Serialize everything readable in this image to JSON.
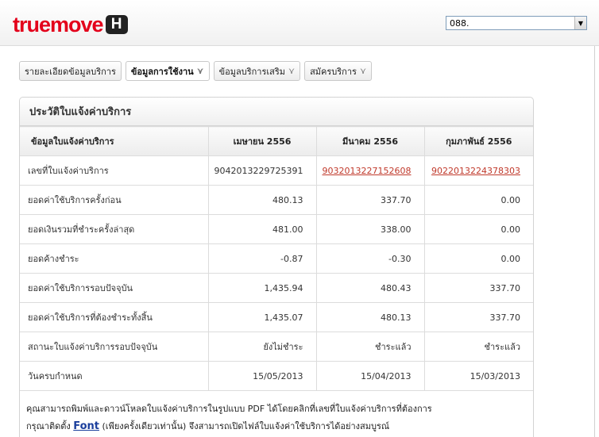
{
  "header": {
    "logo": {
      "part1": "true",
      "part2": "move",
      "badge": "H"
    },
    "number_select": {
      "value": "088."
    }
  },
  "tabs": [
    {
      "label": "รายละเอียดข้อมูลบริการ",
      "has_chevron": false,
      "active": false
    },
    {
      "label": "ข้อมูลการใช้งาน",
      "has_chevron": true,
      "active": true
    },
    {
      "label": "ข้อมูลบริการเสริม",
      "has_chevron": true,
      "active": false
    },
    {
      "label": "สมัครบริการ",
      "has_chevron": true,
      "active": false
    }
  ],
  "chevron_glyph": "⋎",
  "panel": {
    "title": "ประวัติใบแจ้งค่าบริการ",
    "table": {
      "headers": [
        "ข้อมูลใบแจ้งค่าบริการ",
        "เมษายน 2556",
        "มีนาคม 2556",
        "กุมภาพันธ์ 2556"
      ],
      "rows": [
        {
          "label": "เลขที่ใบแจ้งค่าบริการ",
          "cells": [
            "9042013229725391",
            "9032013227152608",
            "9022013224378303"
          ],
          "links": [
            false,
            true,
            true
          ]
        },
        {
          "label": "ยอดค่าใช้บริการครั้งก่อน",
          "cells": [
            "480.13",
            "337.70",
            "0.00"
          ]
        },
        {
          "label": "ยอดเงินรวมที่ชำระครั้งล่าสุด",
          "cells": [
            "481.00",
            "338.00",
            "0.00"
          ]
        },
        {
          "label": "ยอดค้างชำระ",
          "cells": [
            "-0.87",
            "-0.30",
            "0.00"
          ]
        },
        {
          "label": "ยอดค่าใช้บริการรอบปัจจุบัน",
          "cells": [
            "1,435.94",
            "480.43",
            "337.70"
          ]
        },
        {
          "label": "ยอดค่าใช้บริการที่ต้องชำระทั้งสิ้น",
          "cells": [
            "1,435.07",
            "480.13",
            "337.70"
          ]
        },
        {
          "label": "สถานะใบแจ้งค่าบริการรอบปัจจุบัน",
          "cells": [
            "ยังไม่ชำระ",
            "ชำระแล้ว",
            "ชำระแล้ว"
          ]
        },
        {
          "label": "วันครบกำหนด",
          "cells": [
            "15/05/2013",
            "15/04/2013",
            "15/03/2013"
          ]
        }
      ]
    },
    "footnote": {
      "line1": "คุณสามารถพิมพ์และดาวน์โหลดใบแจ้งค่าบริการในรูปแบบ PDF ได้โดยคลิกที่เลขที่ใบแจ้งค่าบริการที่ต้องการ",
      "line2_before": "กรุณาติดตั้ง ",
      "font_link": "Font",
      "line2_after": " (เพียงครั้งเดียวเท่านั้น) จึงสามารถเปิดไฟล์ใบแจ้งค่าใช้บริการได้อย่างสมบูรณ์"
    }
  },
  "colors": {
    "brand_red": "#e3001b",
    "link_red": "#c0392b",
    "link_blue": "#1a3e9c"
  }
}
